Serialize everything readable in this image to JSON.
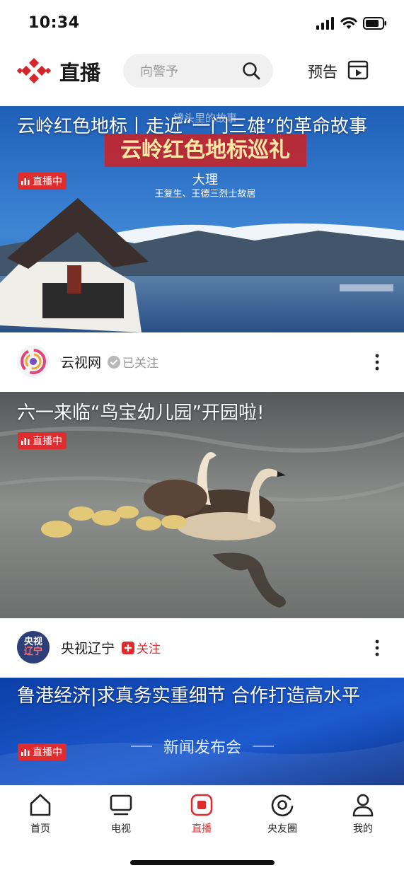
{
  "status_bar": {
    "time": "10:34"
  },
  "header": {
    "title": "直播",
    "search_placeholder": "向警予",
    "preview_label": "预告",
    "brand_color": "#e02b2f"
  },
  "cards": [
    {
      "title": "云岭红色地标丨走近“一门三雄”的革命故事",
      "live_label": "直播中",
      "image_text": {
        "banner": "云岭红色地标巡礼",
        "top_caption": "镜头里的故事",
        "location": "大理",
        "subtitle": "王复生、王德三烈士故居"
      },
      "author": {
        "name": "云视网",
        "follow_label": "已关注",
        "followed": true
      }
    },
    {
      "title": "六一来临“鸟宝幼儿园”开园啦!",
      "live_label": "直播中",
      "author": {
        "name": "央视辽宁",
        "follow_label": "关注",
        "followed": false,
        "avatar_text": [
          "央视",
          "辽宁"
        ]
      }
    },
    {
      "title": "鲁港经济|求真务实重细节 合作打造高水平",
      "live_label": "直播中",
      "image_text": {
        "caption": "新闻发布会"
      }
    }
  ],
  "tabs": [
    {
      "label": "首页",
      "icon": "home-icon"
    },
    {
      "label": "电视",
      "icon": "tv-icon"
    },
    {
      "label": "直播",
      "icon": "live-icon",
      "active": true
    },
    {
      "label": "央友圈",
      "icon": "circle-icon"
    },
    {
      "label": "我的",
      "icon": "profile-icon"
    }
  ]
}
